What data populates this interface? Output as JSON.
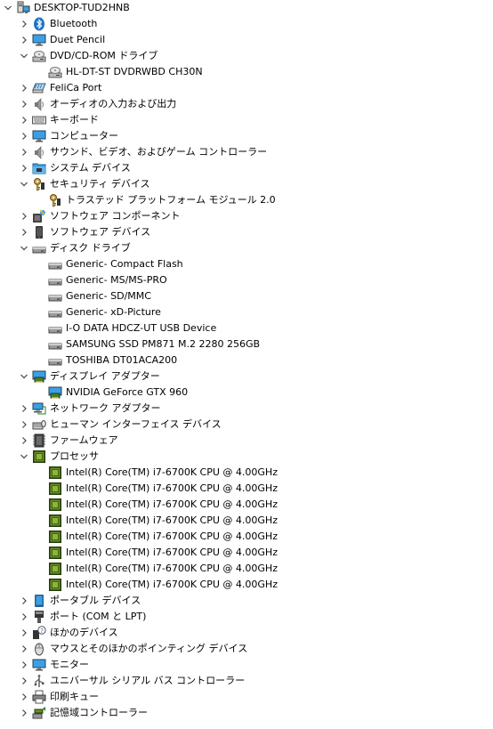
{
  "root": {
    "label": "DESKTOP-TUD2HNB",
    "expanded": true,
    "icon": "computer-icon"
  },
  "nodes": [
    {
      "label": "Bluetooth",
      "icon": "bluetooth-icon",
      "level": 1,
      "expander": "collapsed"
    },
    {
      "label": "Duet Pencil",
      "icon": "monitor-icon",
      "level": 1,
      "expander": "collapsed"
    },
    {
      "label": "DVD/CD-ROM ドライブ",
      "icon": "dvd-drive-icon",
      "level": 1,
      "expander": "expanded"
    },
    {
      "label": "HL-DT-ST DVDRWBD CH30N",
      "icon": "dvd-drive-icon",
      "level": 2,
      "expander": "none"
    },
    {
      "label": "FeliCa Port",
      "icon": "card-reader-icon",
      "level": 1,
      "expander": "collapsed"
    },
    {
      "label": "オーディオの入力および出力",
      "icon": "speaker-icon",
      "level": 1,
      "expander": "collapsed"
    },
    {
      "label": "キーボード",
      "icon": "keyboard-icon",
      "level": 1,
      "expander": "collapsed"
    },
    {
      "label": "コンピューター",
      "icon": "monitor-icon",
      "level": 1,
      "expander": "collapsed"
    },
    {
      "label": "サウンド、ビデオ、およびゲーム コントローラー",
      "icon": "speaker-icon",
      "level": 1,
      "expander": "collapsed"
    },
    {
      "label": "システム デバイス",
      "icon": "folder-chip-icon",
      "level": 1,
      "expander": "collapsed"
    },
    {
      "label": "セキュリティ デバイス",
      "icon": "key-icon",
      "level": 1,
      "expander": "expanded"
    },
    {
      "label": "トラステッド プラットフォーム モジュール 2.0",
      "icon": "key-icon",
      "level": 2,
      "expander": "none"
    },
    {
      "label": "ソフトウェア コンポーネント",
      "icon": "puzzle-icon",
      "level": 1,
      "expander": "collapsed"
    },
    {
      "label": "ソフトウェア デバイス",
      "icon": "phone-icon",
      "level": 1,
      "expander": "collapsed"
    },
    {
      "label": "ディスク ドライブ",
      "icon": "disk-drive-icon",
      "level": 1,
      "expander": "expanded"
    },
    {
      "label": "Generic- Compact Flash",
      "icon": "disk-drive-icon",
      "level": 2,
      "expander": "none"
    },
    {
      "label": "Generic- MS/MS-PRO",
      "icon": "disk-drive-icon",
      "level": 2,
      "expander": "none"
    },
    {
      "label": "Generic- SD/MMC",
      "icon": "disk-drive-icon",
      "level": 2,
      "expander": "none"
    },
    {
      "label": "Generic- xD-Picture",
      "icon": "disk-drive-icon",
      "level": 2,
      "expander": "none"
    },
    {
      "label": "I-O DATA HDCZ-UT USB Device",
      "icon": "disk-drive-icon",
      "level": 2,
      "expander": "none"
    },
    {
      "label": "SAMSUNG SSD PM871 M.2 2280 256GB",
      "icon": "disk-drive-icon",
      "level": 2,
      "expander": "none"
    },
    {
      "label": "TOSHIBA DT01ACA200",
      "icon": "disk-drive-icon",
      "level": 2,
      "expander": "none"
    },
    {
      "label": "ディスプレイ アダプター",
      "icon": "display-adapter-icon",
      "level": 1,
      "expander": "expanded"
    },
    {
      "label": "NVIDIA GeForce GTX 960",
      "icon": "display-adapter-icon",
      "level": 2,
      "expander": "none"
    },
    {
      "label": "ネットワーク アダプター",
      "icon": "network-icon",
      "level": 1,
      "expander": "collapsed"
    },
    {
      "label": "ヒューマン インターフェイス デバイス",
      "icon": "hid-icon",
      "level": 1,
      "expander": "collapsed"
    },
    {
      "label": "ファームウェア",
      "icon": "firmware-icon",
      "level": 1,
      "expander": "collapsed"
    },
    {
      "label": "プロセッサ",
      "icon": "processor-icon",
      "level": 1,
      "expander": "expanded"
    },
    {
      "label": "Intel(R) Core(TM) i7-6700K CPU @ 4.00GHz",
      "icon": "processor-icon",
      "level": 2,
      "expander": "none"
    },
    {
      "label": "Intel(R) Core(TM) i7-6700K CPU @ 4.00GHz",
      "icon": "processor-icon",
      "level": 2,
      "expander": "none"
    },
    {
      "label": "Intel(R) Core(TM) i7-6700K CPU @ 4.00GHz",
      "icon": "processor-icon",
      "level": 2,
      "expander": "none"
    },
    {
      "label": "Intel(R) Core(TM) i7-6700K CPU @ 4.00GHz",
      "icon": "processor-icon",
      "level": 2,
      "expander": "none"
    },
    {
      "label": "Intel(R) Core(TM) i7-6700K CPU @ 4.00GHz",
      "icon": "processor-icon",
      "level": 2,
      "expander": "none"
    },
    {
      "label": "Intel(R) Core(TM) i7-6700K CPU @ 4.00GHz",
      "icon": "processor-icon",
      "level": 2,
      "expander": "none"
    },
    {
      "label": "Intel(R) Core(TM) i7-6700K CPU @ 4.00GHz",
      "icon": "processor-icon",
      "level": 2,
      "expander": "none"
    },
    {
      "label": "Intel(R) Core(TM) i7-6700K CPU @ 4.00GHz",
      "icon": "processor-icon",
      "level": 2,
      "expander": "none"
    },
    {
      "label": "ポータブル デバイス",
      "icon": "portable-device-icon",
      "level": 1,
      "expander": "collapsed"
    },
    {
      "label": "ポート (COM と LPT)",
      "icon": "port-icon",
      "level": 1,
      "expander": "collapsed"
    },
    {
      "label": "ほかのデバイス",
      "icon": "unknown-device-icon",
      "level": 1,
      "expander": "collapsed"
    },
    {
      "label": "マウスとそのほかのポインティング デバイス",
      "icon": "mouse-icon",
      "level": 1,
      "expander": "collapsed"
    },
    {
      "label": "モニター",
      "icon": "monitor-icon",
      "level": 1,
      "expander": "collapsed"
    },
    {
      "label": "ユニバーサル シリアル バス コントローラー",
      "icon": "usb-icon",
      "level": 1,
      "expander": "collapsed"
    },
    {
      "label": "印刷キュー",
      "icon": "printer-icon",
      "level": 1,
      "expander": "collapsed"
    },
    {
      "label": "記憶域コントローラー",
      "icon": "storage-controller-icon",
      "level": 1,
      "expander": "collapsed"
    }
  ],
  "colors": {
    "bluetooth": "#1e73c8",
    "monitor_screen": "#3aa0e6",
    "processor_green": "#6b8e23",
    "processor_border": "#1f3b0f",
    "key_gold": "#c8a040",
    "chevron": "#444444"
  }
}
